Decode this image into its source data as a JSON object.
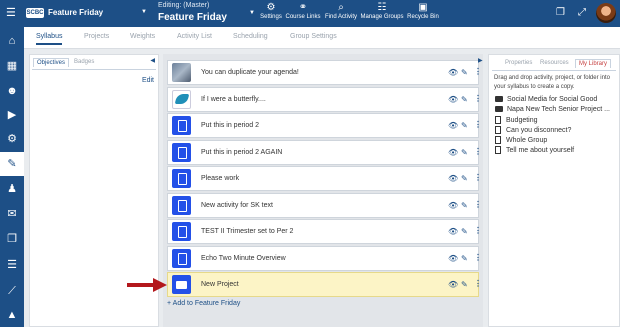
{
  "header": {
    "menu_icon": "hamburger-icon",
    "logo_text": "SCBC",
    "course_name": "Feature Friday",
    "editing_label": "Editing: (Master)",
    "editing_title": "Feature Friday",
    "tools": [
      {
        "icon": "gear-icon",
        "label": "Settings"
      },
      {
        "icon": "link-icon",
        "label": "Course Links"
      },
      {
        "icon": "search-icon",
        "label": "Find Activity"
      },
      {
        "icon": "groups-icon",
        "label": "Manage Groups"
      },
      {
        "icon": "trash-icon",
        "label": "Recycle Bin"
      }
    ]
  },
  "rail": [
    "home-icon",
    "calendar-icon",
    "users-icon",
    "play-icon",
    "settings-icon",
    "pencil-icon",
    "teacher-icon",
    "mail-icon",
    "copy-icon",
    "list-icon",
    "chart-icon",
    "alert-icon"
  ],
  "tabs": [
    "Syllabus",
    "Projects",
    "Weights",
    "Activity List",
    "Scheduling",
    "Group Settings"
  ],
  "left_panel": {
    "tabs": [
      "Objectives",
      "Badges"
    ],
    "edit_label": "Edit"
  },
  "activities": [
    {
      "title": "You can duplicate your agenda!",
      "thumb": "photo"
    },
    {
      "title": "If I were a butterfly....",
      "thumb": "butterfly"
    },
    {
      "title": "Put this in period 2",
      "thumb": "doc"
    },
    {
      "title": "Put this in period 2 AGAIN",
      "thumb": "doc"
    },
    {
      "title": "Please work",
      "thumb": "doc"
    },
    {
      "title": "New activity for SK text",
      "thumb": "doc"
    },
    {
      "title": "TEST II Trimester set to Per 2",
      "thumb": "doc"
    },
    {
      "title": "Echo Two Minute Overview",
      "thumb": "doc"
    },
    {
      "title": "New Project",
      "thumb": "folder"
    }
  ],
  "add_link": "+ Add to Feature Friday",
  "right_panel": {
    "tabs": [
      "Properties",
      "Resources",
      "My Library"
    ],
    "description": "Drag and drop activity, project, or folder into your syllabus to create a copy.",
    "library": [
      {
        "type": "folder",
        "name": "Social Media for Social Good"
      },
      {
        "type": "folder",
        "name": "Napa New Tech Senior Project ..."
      },
      {
        "type": "file",
        "name": "Budgeting"
      },
      {
        "type": "file",
        "name": "Can you disconnect?"
      },
      {
        "type": "file",
        "name": "Whole Group"
      },
      {
        "type": "file",
        "name": "Tell me about yourself"
      }
    ]
  },
  "colors": {
    "primary": "#1d4f86",
    "highlight": "#fcf4c6",
    "arrow": "#b3171c",
    "active_library_tab": "#c64040"
  }
}
